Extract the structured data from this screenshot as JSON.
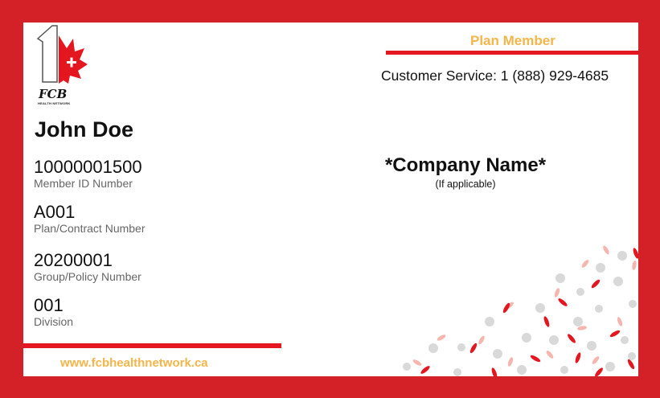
{
  "card": {
    "logo": {
      "text": "FCB",
      "subtext": "HEALTH NETWORK"
    },
    "member_name": "John Doe",
    "fields": [
      {
        "value": "10000001500",
        "label": "Member ID Number"
      },
      {
        "value": "A001",
        "label": "Plan/Contract Number"
      },
      {
        "value": "20200001",
        "label": "Group/Policy Number"
      },
      {
        "value": "001",
        "label": "Division"
      }
    ],
    "plan_member": "Plan Member",
    "customer_service": "Customer Service: 1 (888) 929-4685",
    "company_name": "*Company Name*",
    "company_note": "(If applicable)",
    "website": "www.fcbhealthnetwork.ca"
  },
  "colors": {
    "frame": "#d42027",
    "accent_red": "#e4161f",
    "accent_gold": "#f5b54a",
    "confetti_grey": "#d9d9d9",
    "confetti_pink": "#f4b6ae"
  }
}
